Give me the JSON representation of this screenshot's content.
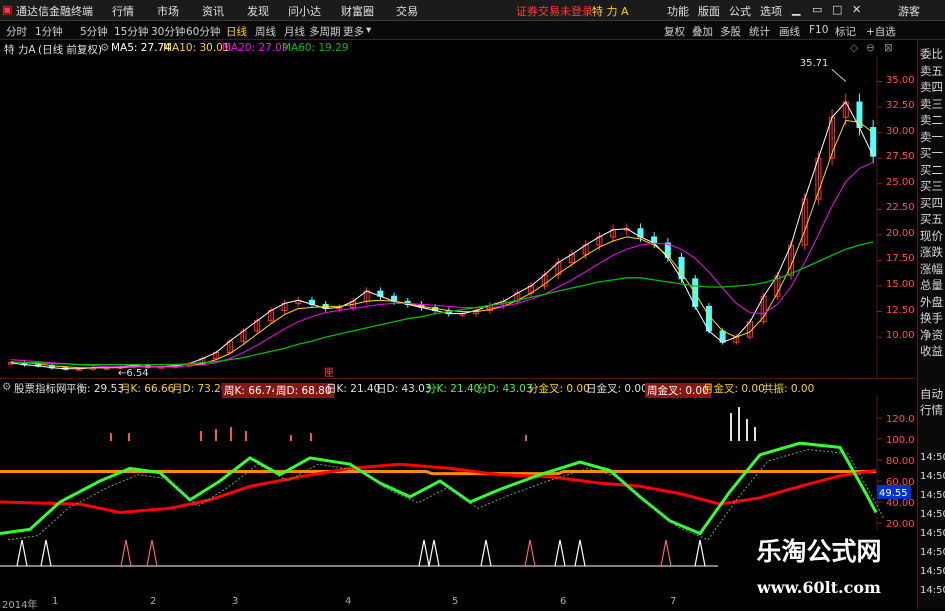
{
  "menubar": {
    "app_title": "通达信金融终端",
    "items": [
      "行情",
      "市场",
      "资讯",
      "发现",
      "问小达",
      "财富圈",
      "交易"
    ],
    "notice": "证券交易未登录",
    "stock": "特 力 A",
    "right_items": [
      "功能",
      "版面",
      "公式",
      "选项"
    ],
    "guest": "游客"
  },
  "periods": {
    "items": [
      "分时",
      "1分钟",
      "5分钟",
      "15分钟",
      "30分钟",
      "60分钟",
      "日线",
      "周线",
      "月线",
      "多周期",
      "更多"
    ],
    "active": "日线",
    "right_buttons": [
      "复权",
      "叠加",
      "多股",
      "统计",
      "画线",
      "F10",
      "标记",
      "+自选"
    ]
  },
  "main_title": {
    "stock": "特 力A",
    "mode": "(日线 前复权)",
    "ma5": "MA5: 27.74",
    "ma10": "MA10: 30.01",
    "ma20": "MA20: 27.09",
    "ma60": "MA60: 19.29"
  },
  "price_axis": [
    "35.00",
    "32.50",
    "30.00",
    "27.50",
    "25.00",
    "22.50",
    "20.00",
    "17.50",
    "15.00",
    "12.50",
    "10.00"
  ],
  "annotations": {
    "high": "35.71",
    "low": "6.54",
    "marker": "匣"
  },
  "indicator_bar": {
    "name": "股票指标网",
    "balance": "平衡: 29.53",
    "month_k": "月K: 66.66",
    "month_d": "月D: 73.26",
    "week_k": "周K: 66.74",
    "week_d": "周D: 68.80",
    "day_k": "日K: 21.40",
    "day_d": "日D: 43.03",
    "min_k": "分K: 21.40",
    "min_d": "分D: 43.03",
    "min_cross": "分金叉: 0.00",
    "day_cross": "日金叉: 0.00",
    "week_cross": "周金叉: 0.00",
    "month_cross": "月金叉: 0.00",
    "resonance": "共振: 0.00"
  },
  "ind_axis": [
    "120.0",
    "100.0",
    "80.00",
    "60.00",
    "40.00",
    "20.00"
  ],
  "ind_value": "49.55",
  "right_panel": [
    "委比",
    "卖五",
    "卖四",
    "卖三",
    "卖二",
    "卖一",
    "买一",
    "买二",
    "买三",
    "买四",
    "买五",
    "现价",
    "涨跌",
    "涨幅",
    "总量",
    "外盘",
    "换手",
    "净资",
    "收益",
    "自动",
    "行情",
    "14:50",
    "14:50",
    "14:50",
    "14:50",
    "14:50",
    "14:50",
    "14:50",
    "14:50"
  ],
  "date_axis": [
    "2014年",
    "1",
    "2",
    "3",
    "4",
    "5",
    "6",
    "7"
  ],
  "watermark": {
    "line1": "乐淘公式网",
    "line2": "www.60lt.com"
  },
  "colors": {
    "up": "#ff3232",
    "down": "#54ffff",
    "ma5": "#ffffff",
    "ma10": "#ffd700",
    "ma20": "#ff00ff",
    "ma60": "#00c000",
    "green_line": "#33ff33",
    "orange_line": "#ff8c00",
    "red_line": "#ff0000"
  },
  "chart_data": {
    "type": "candlestick",
    "ylim": [
      6.0,
      37.5
    ],
    "ma_series": [
      {
        "name": "MA5",
        "values": [
          7.5,
          7.3,
          7.2,
          7.0,
          6.9,
          6.9,
          7.0,
          7.0,
          7.1,
          7.2,
          7.1,
          7.1,
          7.2,
          7.4,
          7.9,
          8.5,
          9.6,
          10.6,
          11.6,
          12.6,
          13.3,
          13.6,
          13.2,
          12.8,
          12.9,
          13.5,
          14.5,
          14.0,
          13.5,
          13.2,
          12.9,
          12.6,
          12.3,
          12.3,
          12.6,
          13.1,
          13.5,
          14.3,
          15.0,
          16.1,
          17.3,
          18.1,
          19.0,
          19.8,
          20.5,
          20.6,
          19.8,
          19.2,
          17.8,
          15.7,
          13.0,
          10.6,
          9.5,
          10.0,
          11.5,
          14.0,
          16.0,
          19.0,
          23.5,
          27.5,
          31.5,
          33.0,
          30.5,
          27.7
        ]
      },
      {
        "name": "MA10",
        "values": [
          7.6,
          7.5,
          7.4,
          7.2,
          7.1,
          7.0,
          7.0,
          7.0,
          7.0,
          7.1,
          7.1,
          7.1,
          7.1,
          7.2,
          7.4,
          7.8,
          8.4,
          9.3,
          10.3,
          11.3,
          12.2,
          12.8,
          12.9,
          13.0,
          13.0,
          13.2,
          13.5,
          13.6,
          13.5,
          13.3,
          13.0,
          12.8,
          12.6,
          12.5,
          12.5,
          12.7,
          13.0,
          13.6,
          14.3,
          15.2,
          16.2,
          17.1,
          18.0,
          18.8,
          19.4,
          19.8,
          19.6,
          19.0,
          18.0,
          16.3,
          14.3,
          12.1,
          10.6,
          10.0,
          10.5,
          12.0,
          14.3,
          17.0,
          20.4,
          24.2,
          28.0,
          31.2,
          31.0,
          30.0
        ]
      },
      {
        "name": "MA20",
        "values": [
          7.8,
          7.7,
          7.6,
          7.5,
          7.4,
          7.3,
          7.2,
          7.1,
          7.1,
          7.1,
          7.1,
          7.1,
          7.1,
          7.2,
          7.3,
          7.5,
          7.9,
          8.5,
          9.2,
          10.0,
          10.8,
          11.5,
          12.0,
          12.4,
          12.6,
          12.8,
          13.0,
          13.2,
          13.3,
          13.3,
          13.2,
          13.1,
          13.0,
          12.9,
          12.9,
          12.9,
          13.0,
          13.3,
          13.7,
          14.2,
          14.9,
          15.6,
          16.4,
          17.2,
          18.0,
          18.6,
          19.0,
          19.2,
          19.1,
          18.6,
          17.7,
          16.4,
          14.8,
          13.3,
          12.4,
          12.3,
          13.2,
          14.9,
          17.3,
          20.0,
          22.8,
          25.2,
          26.5,
          27.1
        ]
      },
      {
        "name": "MA60",
        "values": [
          7.6,
          7.5,
          7.5,
          7.4,
          7.4,
          7.3,
          7.3,
          7.3,
          7.3,
          7.3,
          7.3,
          7.3,
          7.3,
          7.4,
          7.5,
          7.6,
          7.8,
          8.0,
          8.3,
          8.6,
          8.9,
          9.3,
          9.6,
          10.0,
          10.3,
          10.6,
          10.9,
          11.2,
          11.5,
          11.8,
          12.0,
          12.3,
          12.5,
          12.7,
          12.9,
          13.1,
          13.3,
          13.6,
          13.9,
          14.2,
          14.5,
          14.8,
          15.1,
          15.4,
          15.6,
          15.8,
          15.8,
          15.6,
          15.4,
          15.2,
          15.0,
          14.9,
          14.9,
          15.0,
          15.1,
          15.3,
          15.7,
          16.2,
          16.8,
          17.4,
          18.0,
          18.6,
          19.0,
          19.3
        ]
      }
    ]
  }
}
